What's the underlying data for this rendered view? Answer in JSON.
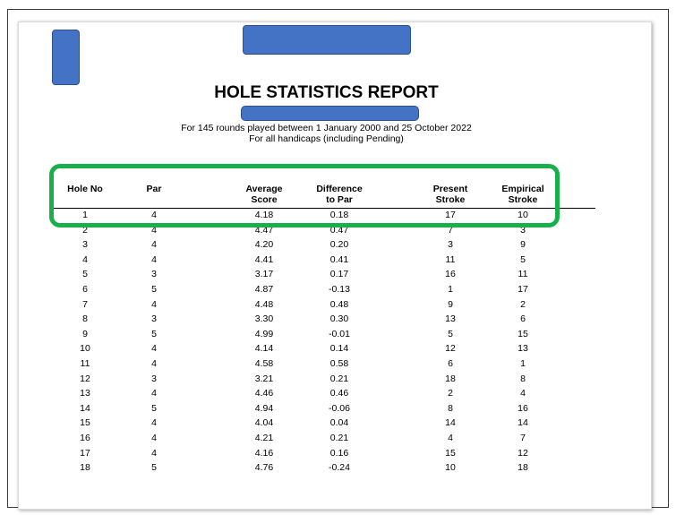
{
  "report": {
    "title": "HOLE STATISTICS REPORT",
    "subtitle_line1": "For 145 rounds played between 1 January 2000 and 25 October 2022",
    "subtitle_line2": "For all handicaps (including Pending)"
  },
  "columns": {
    "hole_no": "Hole No",
    "par": "Par",
    "average_score_1": "Average",
    "average_score_2": "Score",
    "difference_1": "Difference",
    "difference_2": "to Par",
    "present_stroke_1": "Present",
    "present_stroke_2": "Stroke",
    "empirical_stroke_1": "Empirical",
    "empirical_stroke_2": "Stroke"
  },
  "rows": [
    {
      "hole": "1",
      "par": "4",
      "avg": "4.18",
      "diff": "0.18",
      "present": "17",
      "empirical": "10"
    },
    {
      "hole": "2",
      "par": "4",
      "avg": "4.47",
      "diff": "0.47",
      "present": "7",
      "empirical": "3"
    },
    {
      "hole": "3",
      "par": "4",
      "avg": "4.20",
      "diff": "0.20",
      "present": "3",
      "empirical": "9"
    },
    {
      "hole": "4",
      "par": "4",
      "avg": "4.41",
      "diff": "0.41",
      "present": "11",
      "empirical": "5"
    },
    {
      "hole": "5",
      "par": "3",
      "avg": "3.17",
      "diff": "0.17",
      "present": "16",
      "empirical": "11"
    },
    {
      "hole": "6",
      "par": "5",
      "avg": "4.87",
      "diff": "-0.13",
      "present": "1",
      "empirical": "17"
    },
    {
      "hole": "7",
      "par": "4",
      "avg": "4.48",
      "diff": "0.48",
      "present": "9",
      "empirical": "2"
    },
    {
      "hole": "8",
      "par": "3",
      "avg": "3.30",
      "diff": "0.30",
      "present": "13",
      "empirical": "6"
    },
    {
      "hole": "9",
      "par": "5",
      "avg": "4.99",
      "diff": "-0.01",
      "present": "5",
      "empirical": "15"
    },
    {
      "hole": "10",
      "par": "4",
      "avg": "4.14",
      "diff": "0.14",
      "present": "12",
      "empirical": "13"
    },
    {
      "hole": "11",
      "par": "4",
      "avg": "4.58",
      "diff": "0.58",
      "present": "6",
      "empirical": "1"
    },
    {
      "hole": "12",
      "par": "3",
      "avg": "3.21",
      "diff": "0.21",
      "present": "18",
      "empirical": "8"
    },
    {
      "hole": "13",
      "par": "4",
      "avg": "4.46",
      "diff": "0.46",
      "present": "2",
      "empirical": "4"
    },
    {
      "hole": "14",
      "par": "5",
      "avg": "4.94",
      "diff": "-0.06",
      "present": "8",
      "empirical": "16"
    },
    {
      "hole": "15",
      "par": "4",
      "avg": "4.04",
      "diff": "0.04",
      "present": "14",
      "empirical": "14"
    },
    {
      "hole": "16",
      "par": "4",
      "avg": "4.21",
      "diff": "0.21",
      "present": "4",
      "empirical": "7"
    },
    {
      "hole": "17",
      "par": "4",
      "avg": "4.16",
      "diff": "0.16",
      "present": "15",
      "empirical": "12"
    },
    {
      "hole": "18",
      "par": "5",
      "avg": "4.76",
      "diff": "-0.24",
      "present": "10",
      "empirical": "18"
    }
  ],
  "colors": {
    "redaction": "#4472c4",
    "highlight": "#18b04a"
  }
}
